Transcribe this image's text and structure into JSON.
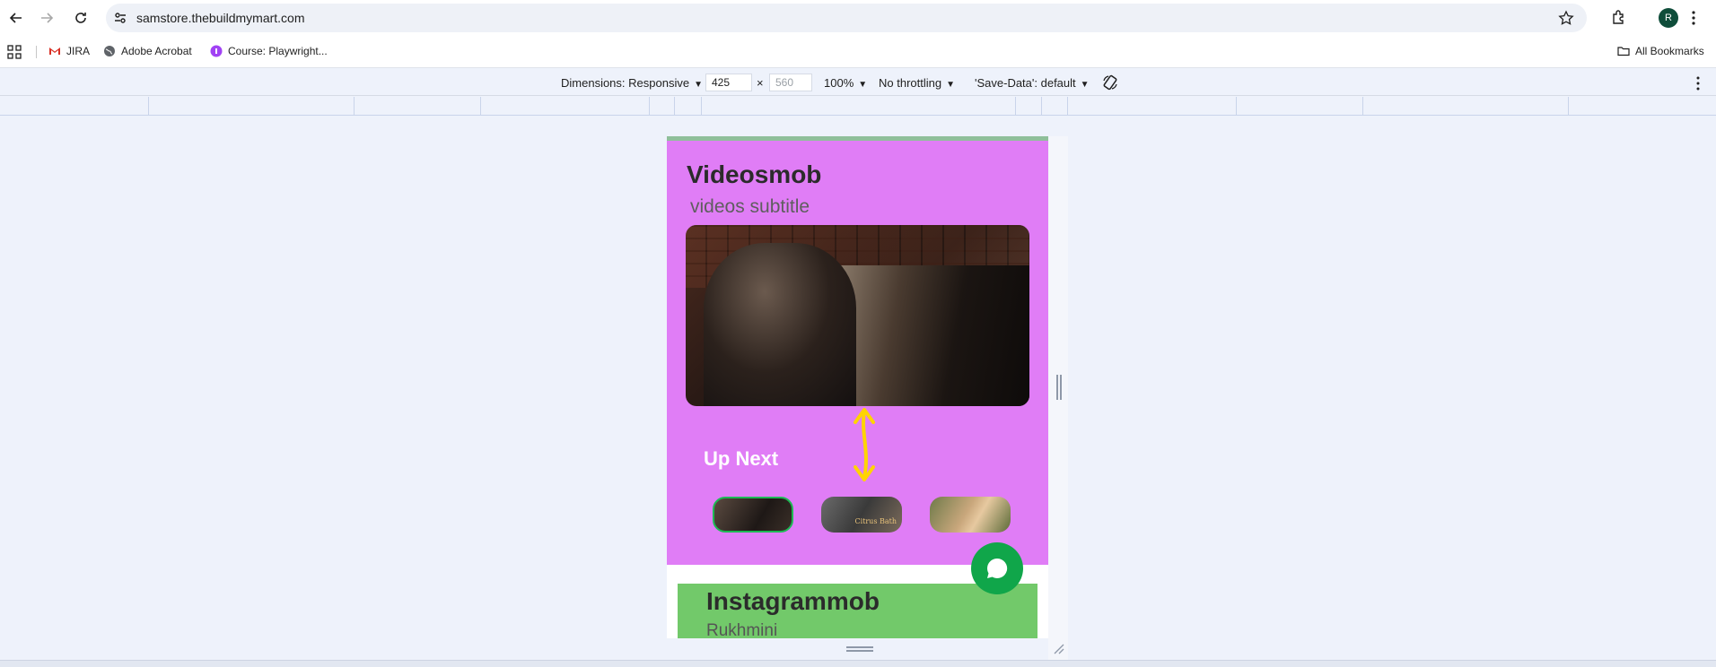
{
  "browser": {
    "url": "samstore.thebuildmymart.com",
    "avatar_letter": "R",
    "accent": "#0f4d3a"
  },
  "bookmarks": {
    "items": [
      {
        "label": "JIRA",
        "icon": "gmail-icon"
      },
      {
        "label": "Adobe Acrobat",
        "icon": "globe-icon"
      },
      {
        "label": "Course: Playwright...",
        "icon": "course-icon"
      }
    ],
    "all_bookmarks": "All Bookmarks"
  },
  "devtools": {
    "dimensions_label": "Dimensions: Responsive",
    "width": "425",
    "height": "560",
    "zoom": "100%",
    "throttling": "No throttling",
    "save_data": "'Save-Data': default"
  },
  "page": {
    "videos": {
      "title": "Videosmob",
      "subtitle": "videos subtitle",
      "up_next_label": "Up Next",
      "thumb2_caption": "Citrus Bath",
      "bg_color": "#e07df6"
    },
    "instagram": {
      "title": "Instagrammob",
      "subtitle": "Rukhmini",
      "bg_color": "#72c96a"
    },
    "chat_color": "#10a64a"
  }
}
